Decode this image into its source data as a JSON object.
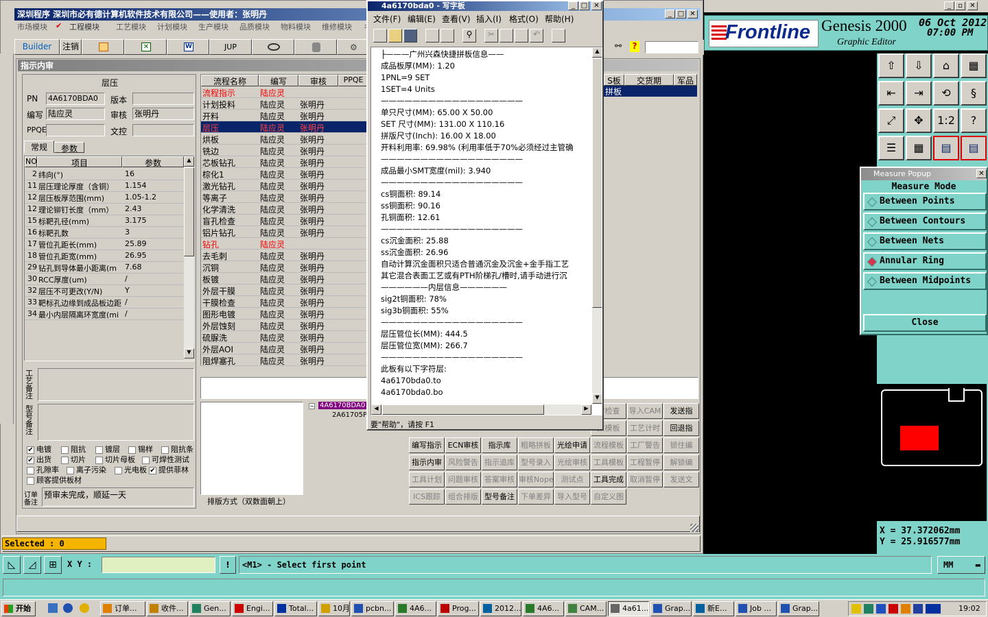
{
  "main_window": {
    "title": "深圳程序  深圳市必有德计算机软件技术有限公司——使用者：张明丹",
    "menu": [
      "市场模块",
      "工程模块",
      "工艺模块",
      "计划模块",
      "生产模块",
      "品质模块",
      "物料模块",
      "维修模块",
      "彳"
    ],
    "toolbar": [
      "Builder",
      "注销",
      "JUP"
    ]
  },
  "sub_window": {
    "title": "指示内审"
  },
  "left_panel": {
    "header": "层压",
    "pn_label": "PN",
    "pn": "4A6170BDA0",
    "version_label": "版本",
    "version": "",
    "writer_label": "编写",
    "writer": "陆应灵",
    "reviewer_label": "审核",
    "reviewer": "张明丹",
    "ppqe_label": "PPQE",
    "ppqe": "",
    "ww_label": "文控",
    "ww": "",
    "tabs": [
      "常规",
      "参数"
    ],
    "grid_headers": [
      "NO",
      "项目",
      "参数"
    ],
    "grid_rows": [
      [
        "2",
        "纬向(°)",
        "16"
      ],
      [
        "11",
        "层压理论厚度（含铜）",
        "1.154"
      ],
      [
        "12",
        "层压板厚范围(mm)",
        "1.05-1.2"
      ],
      [
        "12",
        "理论铆钉长度（mm）",
        "2.43"
      ],
      [
        "15",
        "标靶孔径(mm)",
        "3.175"
      ],
      [
        "16",
        "标靶孔数",
        "3"
      ],
      [
        "17",
        "管位孔距长(mm)",
        "25.89"
      ],
      [
        "18",
        "管位孔距宽(mm)",
        "26.95"
      ],
      [
        "29",
        "钻孔到导体最小距离(m",
        "7.68"
      ],
      [
        "30",
        "RCC厚度(um)",
        "/"
      ],
      [
        "32",
        "层压不可更改(Y/N)",
        "Y"
      ],
      [
        "33",
        "靶标孔边缘到成品板边距",
        "/"
      ],
      [
        "34",
        "最小内层隔离环宽度(mi",
        "/"
      ]
    ],
    "notes_label": "工艺备注",
    "type_note_label": "型号备注",
    "checks": [
      {
        "label": "电镀",
        "checked": true
      },
      {
        "label": "阻抗",
        "checked": false
      },
      {
        "label": "镀层",
        "checked": false
      },
      {
        "label": "锡样",
        "checked": false
      },
      {
        "label": "阻抗条",
        "checked": false
      },
      {
        "label": "出货",
        "checked": true
      },
      {
        "label": "切片",
        "checked": false
      },
      {
        "label": "切片母板",
        "checked": false
      },
      {
        "label": "可焊性测试",
        "checked": false
      },
      {
        "label": "孔隙率",
        "checked": false
      },
      {
        "label": "离子污染",
        "checked": false
      },
      {
        "label": "光电板",
        "checked": false
      },
      {
        "label": "提供菲林",
        "checked": true
      },
      {
        "label": "顾客提供板材",
        "checked": false
      }
    ],
    "order_note_label": "订单备注",
    "order_note": "预审未完成，顺延一天"
  },
  "process_table": {
    "headers": [
      "流程名称",
      "编写",
      "审核",
      "PPQE"
    ],
    "rows": [
      [
        "流程指示",
        "陆应灵",
        ""
      ],
      [
        "计划投料",
        "陆应灵",
        "张明丹"
      ],
      [
        "开料",
        "陆应灵",
        "张明丹"
      ],
      [
        "层压",
        "陆应灵",
        "张明丹"
      ],
      [
        "烘板",
        "陆应灵",
        "张明丹"
      ],
      [
        "铣边",
        "陆应灵",
        "张明丹"
      ],
      [
        "芯板钻孔",
        "陆应灵",
        "张明丹"
      ],
      [
        "棕化1",
        "陆应灵",
        "张明丹"
      ],
      [
        "激光钻孔",
        "陆应灵",
        "张明丹"
      ],
      [
        "等离子",
        "陆应灵",
        "张明丹"
      ],
      [
        "化学清洗",
        "陆应灵",
        "张明丹"
      ],
      [
        "盲孔检查",
        "陆应灵",
        "张明丹"
      ],
      [
        "铝片钻孔",
        "陆应灵",
        "张明丹"
      ],
      [
        "钻孔",
        "陆应灵",
        ""
      ],
      [
        "去毛刺",
        "陆应灵",
        "张明丹"
      ],
      [
        "沉铜",
        "陆应灵",
        "张明丹"
      ],
      [
        "板镀",
        "陆应灵",
        "张明丹"
      ],
      [
        "外层干膜",
        "陆应灵",
        "张明丹"
      ],
      [
        "干膜检查",
        "陆应灵",
        "张明丹"
      ],
      [
        "图形电镀",
        "陆应灵",
        "张明丹"
      ],
      [
        "外层蚀刻",
        "陆应灵",
        "张明丹"
      ],
      [
        "硫脲洗",
        "陆应灵",
        "张明丹"
      ],
      [
        "外层AOI",
        "陆应灵",
        "张明丹"
      ],
      [
        "阻焊塞孔",
        "陆应灵",
        "张明丹"
      ]
    ],
    "layout_label": "排版方式（双数面朝上）"
  },
  "right_grid": {
    "headers": [
      "S板",
      "交货期",
      "军品"
    ],
    "row": [
      "拼板",
      "",
      ""
    ]
  },
  "tree": {
    "root": "4A6170BDA0",
    "child": "2A61705P"
  },
  "action_buttons": [
    [
      "",
      "",
      "",
      "",
      "",
      "审检查",
      "导入CAM",
      "发送指"
    ],
    [
      "",
      "",
      "",
      "",
      "",
      "数模板",
      "工艺计时",
      "回退指"
    ],
    [
      "编写指示",
      "ECN审核",
      "指示库",
      "粗略拼板",
      "光绘申请",
      "流程模板",
      "工厂警告",
      "锁住编"
    ],
    [
      "指示内审",
      "风险警告",
      "指示追库",
      "型号录入",
      "光绘审核",
      "工具模板",
      "工程暂停",
      "解锁编"
    ],
    [
      "工具计划",
      "问题审核",
      "答案审核",
      "审核Nope",
      "测试点",
      "工具完成",
      "取消暂停",
      "发送文"
    ],
    [
      "ICS跟踪",
      "组合排版",
      "型号备注",
      "下单差异",
      "导入型号",
      "自定义图",
      "",
      ""
    ]
  ],
  "wordpad": {
    "title": "4a6170bda0 - 写字板",
    "menu": [
      "文件(F)",
      "编辑(E)",
      "查看(V)",
      "插入(I)",
      "格式(O)",
      "帮助(H)"
    ],
    "status": "要\"帮助\"，请按 F1",
    "lines": [
      "├———广州兴森快捷拼板信息——",
      "成品板厚(MM): 1.20",
      "1PNL=9 SET",
      "1SET=4 Units",
      "——————————————————",
      "单只尺寸(MM): 65.00 X 50.00",
      "SET 尺寸(MM): 131.00 X 110.16",
      "拼版尺寸(Inch): 16.00 X 18.00",
      "开料利用率: 69.98% (利用率低于70%必须经过主管确",
      "——————————————————",
      "成品最小SMT宽度(mil): 3.940",
      "——————————————————",
      "cs铜面积: 89.14",
      "ss铜面积: 90.16",
      "孔铜面积: 12.61",
      "——————————————————",
      "cs沉金面积: 25.88",
      "ss沉金面积: 26.96",
      "自动计算沉金面积只适合普通沉金及沉金+金手指工艺",
      "其它混合表面工艺或有PTH阶梯孔/槽时,请手动进行沉",
      "——————内层信息——————",
      "sig2t铜面积: 78%",
      "sig3b铜面积: 55%",
      "——————————————————",
      "层压管位长(MM): 444.5",
      "层压管位宽(MM): 266.7",
      "——————————————————",
      "此板有以下字符层:",
      "4a6170bda0.to",
      "4a6170bda0.bo"
    ]
  },
  "genesis": {
    "logo": "Frontline",
    "product": "Genesis 2000",
    "subtitle": "Graphic Editor",
    "date": "06 Oct 2012",
    "time": "07:00 PM",
    "x_readout": "X  =  37.372062mm",
    "y_readout": "Y  =  25.916577mm",
    "units": "MM"
  },
  "measure_popup": {
    "title": "Measure Popup",
    "header": "Measure Mode",
    "options": [
      {
        "label": "Between Points",
        "selected": false
      },
      {
        "label": "Between Contours",
        "selected": false
      },
      {
        "label": "Between Nets",
        "selected": false
      },
      {
        "label": "Annular Ring",
        "selected": true
      },
      {
        "label": "Between Midpoints",
        "selected": false
      }
    ],
    "close": "Close"
  },
  "status": {
    "selected": "Selected : 0",
    "xy_label": "X Y :",
    "xy_value": "",
    "prompt": "<M1> - Select first point"
  },
  "taskbar": {
    "start": "开始",
    "items": [
      "订单...",
      "收件...",
      "Gen...",
      "Engi...",
      "Total...",
      "10月",
      "pcbn...",
      "4A6...",
      "Prog...",
      "2012...",
      "4A6...",
      "CAM...",
      "4a61...",
      "Grap...",
      "新E...",
      "Job ...",
      "Grap..."
    ],
    "clock": "19:02"
  }
}
